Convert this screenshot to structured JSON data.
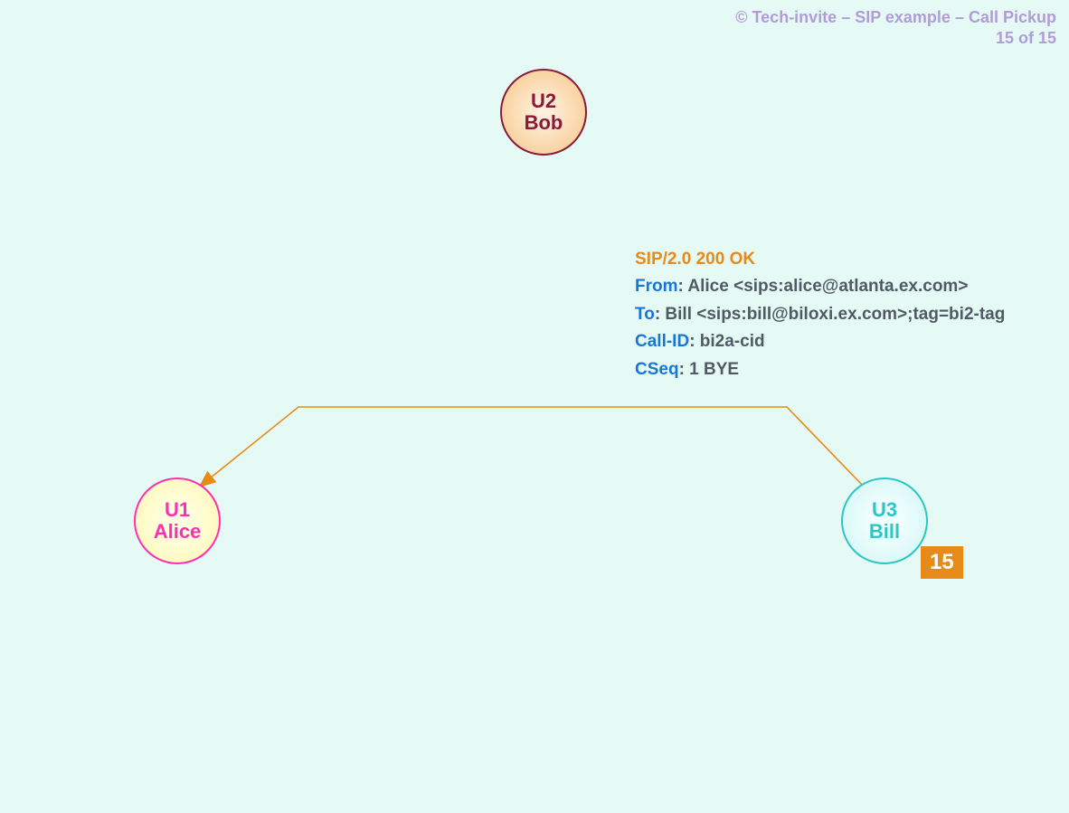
{
  "header": {
    "line1": "© Tech-invite – SIP example – Call Pickup",
    "line2": "15 of 15"
  },
  "nodes": {
    "u2": {
      "id": "U2",
      "name": "Bob"
    },
    "u1": {
      "id": "U1",
      "name": "Alice"
    },
    "u3": {
      "id": "U3",
      "name": "Bill"
    }
  },
  "step_badge": "15",
  "sip": {
    "status_line": "SIP/2.0 200 OK",
    "from_label": "From",
    "from_value": ": Alice <sips:alice@atlanta.ex.com>",
    "to_label": "To",
    "to_value": ": Bill <sips:bill@biloxi.ex.com>;tag=bi2-tag",
    "callid_label": "Call-ID",
    "callid_value": ": bi2a-cid",
    "cseq_label": "CSeq",
    "cseq_value": ": 1 BYE"
  },
  "arrow": {
    "color": "#e88a17",
    "from": "U3",
    "to": "U1"
  }
}
